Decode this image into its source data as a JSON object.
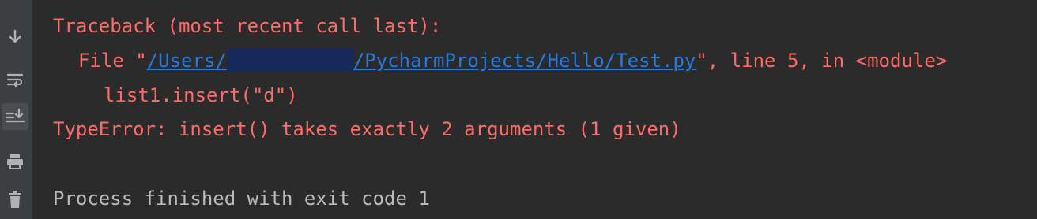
{
  "toolbar": {
    "icons": [
      {
        "name": "scroll-down-icon",
        "color": "#afb1b3"
      },
      {
        "name": "soft-wrap-icon",
        "color": "#afb1b3"
      },
      {
        "name": "scroll-to-end-icon",
        "color": "#afb1b3",
        "active": true
      },
      {
        "name": "print-icon",
        "color": "#afb1b3"
      },
      {
        "name": "trash-icon",
        "color": "#afb1b3"
      }
    ]
  },
  "console": {
    "traceback_header": "Traceback (most recent call last):",
    "file_prefix": "File \"",
    "file_link_start": "/Users/",
    "file_link_end": "/PycharmProjects/Hello/Test.py",
    "file_suffix": "\", line 5, in <module>",
    "code_line": "list1.insert(\"d\")",
    "error_line": "TypeError: insert() takes exactly 2 arguments (1 given)",
    "process_line": "Process finished with exit code 1"
  },
  "colors": {
    "background": "#2b2b2b",
    "error_text": "#ff6b68",
    "normal_text": "#bbbbbb",
    "link": "#287bde",
    "toolbar_bg": "#3c3f41"
  }
}
